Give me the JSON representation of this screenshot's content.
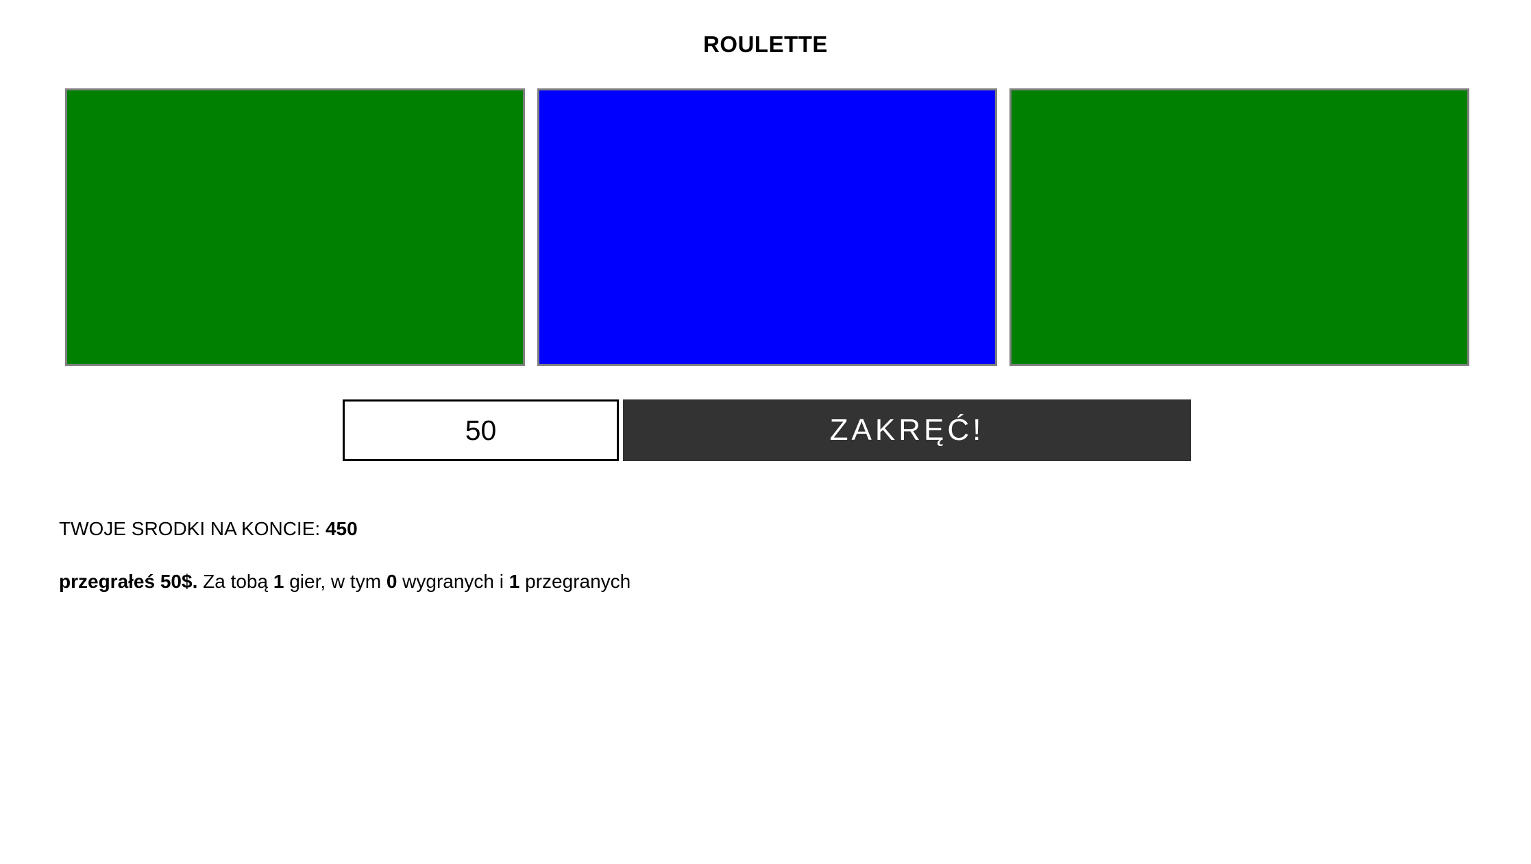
{
  "title": "ROULETTE",
  "slots": [
    {
      "color": "#008000"
    },
    {
      "color": "#0000ff"
    },
    {
      "color": "#008000"
    }
  ],
  "bet": {
    "value": "50"
  },
  "spin_button": {
    "label": "ZAKRĘĆ!"
  },
  "balance": {
    "label": "TWOJE SRODKI NA KONCIE: ",
    "value": "450"
  },
  "result": {
    "outcome": "przegrałeś 50$.",
    "text1": " Za tobą ",
    "games": "1",
    "text2": " gier, w tym ",
    "wins": "0",
    "text3": " wygranych i ",
    "losses": "1",
    "text4": " przegranych"
  }
}
